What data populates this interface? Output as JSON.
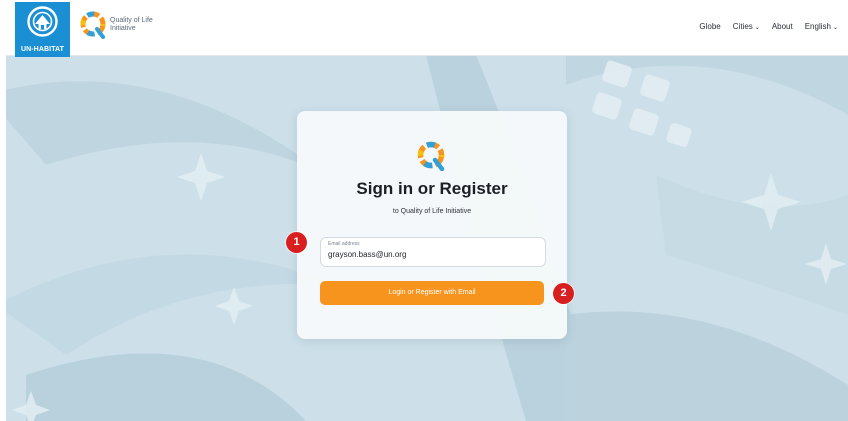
{
  "header": {
    "org_logo_text": "UN-HABITAT",
    "product_name_line1": "Quality of Life",
    "product_name_line2": "Initiative",
    "nav": [
      {
        "label": "Globe",
        "has_dropdown": false
      },
      {
        "label": "Cities",
        "has_dropdown": true
      },
      {
        "label": "About",
        "has_dropdown": false
      },
      {
        "label": "English",
        "has_dropdown": true
      }
    ]
  },
  "login_card": {
    "title": "Sign in or Register",
    "subtitle": "to Quality of Life Initiative",
    "email_label": "Email address",
    "email_value": "grayson.bass@un.org",
    "submit_label": "Login or Register with Email"
  },
  "annotations": {
    "marker_1": "1",
    "marker_2": "2"
  },
  "colors": {
    "brand_blue": "#1a8fd4",
    "button_orange": "#f7941d",
    "marker_red": "#d81f1f",
    "background": "#cfe2ea"
  },
  "icons": [
    "un-habitat-emblem-icon",
    "qol-logo-icon",
    "chevron-down-icon"
  ]
}
